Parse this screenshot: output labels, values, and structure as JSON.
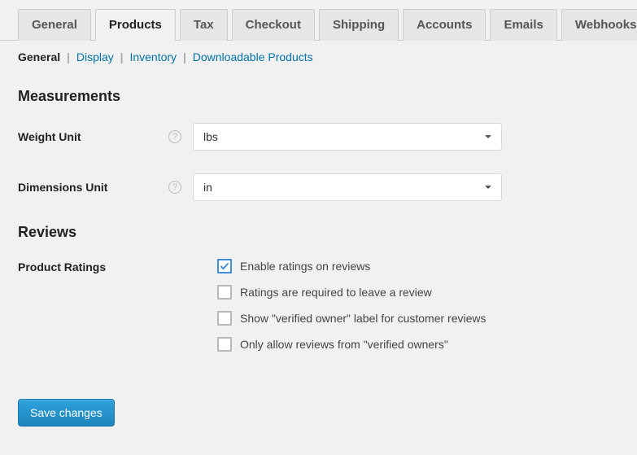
{
  "tabs": {
    "general": "General",
    "products": "Products",
    "tax": "Tax",
    "checkout": "Checkout",
    "shipping": "Shipping",
    "accounts": "Accounts",
    "emails": "Emails",
    "webhooks": "Webhooks"
  },
  "subnav": {
    "general": "General",
    "display": "Display",
    "inventory": "Inventory",
    "downloadable": "Downloadable Products"
  },
  "sections": {
    "measurements": "Measurements",
    "reviews": "Reviews"
  },
  "fields": {
    "weight_unit": {
      "label": "Weight Unit",
      "value": "lbs"
    },
    "dimensions_unit": {
      "label": "Dimensions Unit",
      "value": "in"
    },
    "product_ratings": {
      "label": "Product Ratings"
    }
  },
  "ratings_options": {
    "enable": "Enable ratings on reviews",
    "required": "Ratings are required to leave a review",
    "verified_label": "Show \"verified owner\" label for customer reviews",
    "verified_only": "Only allow reviews from \"verified owners\""
  },
  "buttons": {
    "save": "Save changes"
  }
}
